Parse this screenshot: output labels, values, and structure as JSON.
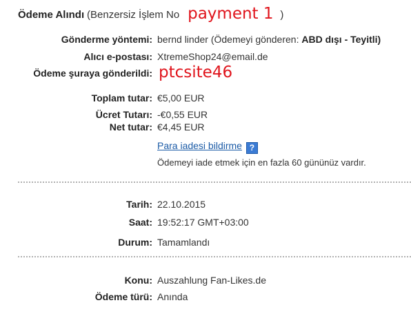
{
  "header": {
    "title": "Ödeme Alındı",
    "subtitle": "(Benzersiz İşlem No",
    "annotation": "payment 1",
    "closing": ")"
  },
  "details": {
    "method_label": "Gönderme yöntemi:",
    "method_value_prefix": "bernd linder (Ödemeyi gönderen: ",
    "method_value_bold": "ABD dışı - Teyitli)",
    "email_label": "Alıcı e-postası:",
    "email_value": "XtremeShop24@email.de",
    "sent_to_label": "Ödeme şuraya gönderildi:",
    "sent_to_annotation": "ptcsite46"
  },
  "amounts": {
    "total_label": "Toplam tutar:",
    "total_value": "€5,00 EUR",
    "fee_label": "Ücret Tutarı:",
    "fee_value": "-€0,55 EUR",
    "net_label": "Net tutar:",
    "net_value": "€4,45 EUR",
    "refund_link": "Para iadesi bildirme",
    "help_icon": "question-mark-icon",
    "refund_note": "Ödemeyi iade etmek için en fazla 60 gününüz vardır."
  },
  "status": {
    "date_label": "Tarih:",
    "date_value": "22.10.2015",
    "time_label": "Saat:",
    "time_value": "19:52:17 GMT+03:00",
    "state_label": "Durum:",
    "state_value": "Tamamlandı"
  },
  "info": {
    "subject_label": "Konu:",
    "subject_value": "Auszahlung Fan-Likes.de",
    "type_label": "Ödeme türü:",
    "type_value": "Anında"
  },
  "colors": {
    "annotation": "#e0141c",
    "link": "#1a5aa6",
    "help_icon": "#3b7bd4"
  }
}
